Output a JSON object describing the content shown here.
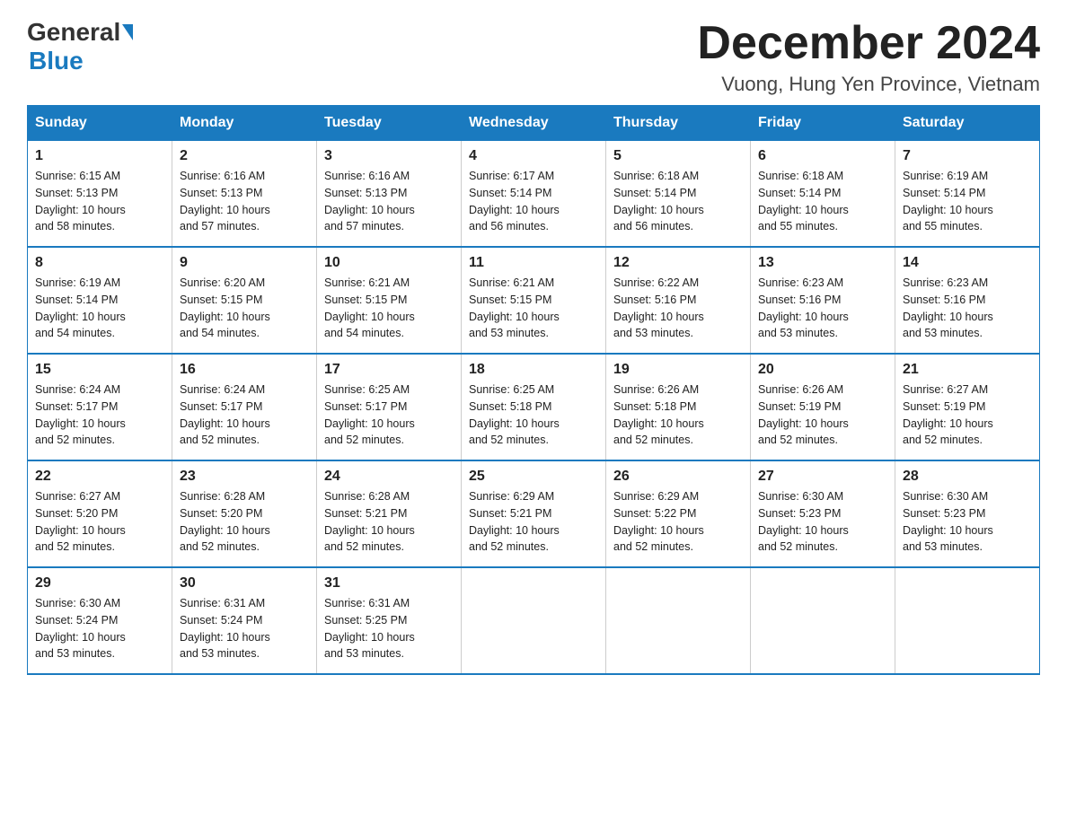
{
  "logo": {
    "general": "General",
    "blue": "Blue"
  },
  "header": {
    "title": "December 2024",
    "location": "Vuong, Hung Yen Province, Vietnam"
  },
  "days_of_week": [
    "Sunday",
    "Monday",
    "Tuesday",
    "Wednesday",
    "Thursday",
    "Friday",
    "Saturday"
  ],
  "weeks": [
    [
      {
        "day": "1",
        "sunrise": "6:15 AM",
        "sunset": "5:13 PM",
        "daylight": "10 hours and 58 minutes."
      },
      {
        "day": "2",
        "sunrise": "6:16 AM",
        "sunset": "5:13 PM",
        "daylight": "10 hours and 57 minutes."
      },
      {
        "day": "3",
        "sunrise": "6:16 AM",
        "sunset": "5:13 PM",
        "daylight": "10 hours and 57 minutes."
      },
      {
        "day": "4",
        "sunrise": "6:17 AM",
        "sunset": "5:14 PM",
        "daylight": "10 hours and 56 minutes."
      },
      {
        "day": "5",
        "sunrise": "6:18 AM",
        "sunset": "5:14 PM",
        "daylight": "10 hours and 56 minutes."
      },
      {
        "day": "6",
        "sunrise": "6:18 AM",
        "sunset": "5:14 PM",
        "daylight": "10 hours and 55 minutes."
      },
      {
        "day": "7",
        "sunrise": "6:19 AM",
        "sunset": "5:14 PM",
        "daylight": "10 hours and 55 minutes."
      }
    ],
    [
      {
        "day": "8",
        "sunrise": "6:19 AM",
        "sunset": "5:14 PM",
        "daylight": "10 hours and 54 minutes."
      },
      {
        "day": "9",
        "sunrise": "6:20 AM",
        "sunset": "5:15 PM",
        "daylight": "10 hours and 54 minutes."
      },
      {
        "day": "10",
        "sunrise": "6:21 AM",
        "sunset": "5:15 PM",
        "daylight": "10 hours and 54 minutes."
      },
      {
        "day": "11",
        "sunrise": "6:21 AM",
        "sunset": "5:15 PM",
        "daylight": "10 hours and 53 minutes."
      },
      {
        "day": "12",
        "sunrise": "6:22 AM",
        "sunset": "5:16 PM",
        "daylight": "10 hours and 53 minutes."
      },
      {
        "day": "13",
        "sunrise": "6:23 AM",
        "sunset": "5:16 PM",
        "daylight": "10 hours and 53 minutes."
      },
      {
        "day": "14",
        "sunrise": "6:23 AM",
        "sunset": "5:16 PM",
        "daylight": "10 hours and 53 minutes."
      }
    ],
    [
      {
        "day": "15",
        "sunrise": "6:24 AM",
        "sunset": "5:17 PM",
        "daylight": "10 hours and 52 minutes."
      },
      {
        "day": "16",
        "sunrise": "6:24 AM",
        "sunset": "5:17 PM",
        "daylight": "10 hours and 52 minutes."
      },
      {
        "day": "17",
        "sunrise": "6:25 AM",
        "sunset": "5:17 PM",
        "daylight": "10 hours and 52 minutes."
      },
      {
        "day": "18",
        "sunrise": "6:25 AM",
        "sunset": "5:18 PM",
        "daylight": "10 hours and 52 minutes."
      },
      {
        "day": "19",
        "sunrise": "6:26 AM",
        "sunset": "5:18 PM",
        "daylight": "10 hours and 52 minutes."
      },
      {
        "day": "20",
        "sunrise": "6:26 AM",
        "sunset": "5:19 PM",
        "daylight": "10 hours and 52 minutes."
      },
      {
        "day": "21",
        "sunrise": "6:27 AM",
        "sunset": "5:19 PM",
        "daylight": "10 hours and 52 minutes."
      }
    ],
    [
      {
        "day": "22",
        "sunrise": "6:27 AM",
        "sunset": "5:20 PM",
        "daylight": "10 hours and 52 minutes."
      },
      {
        "day": "23",
        "sunrise": "6:28 AM",
        "sunset": "5:20 PM",
        "daylight": "10 hours and 52 minutes."
      },
      {
        "day": "24",
        "sunrise": "6:28 AM",
        "sunset": "5:21 PM",
        "daylight": "10 hours and 52 minutes."
      },
      {
        "day": "25",
        "sunrise": "6:29 AM",
        "sunset": "5:21 PM",
        "daylight": "10 hours and 52 minutes."
      },
      {
        "day": "26",
        "sunrise": "6:29 AM",
        "sunset": "5:22 PM",
        "daylight": "10 hours and 52 minutes."
      },
      {
        "day": "27",
        "sunrise": "6:30 AM",
        "sunset": "5:23 PM",
        "daylight": "10 hours and 52 minutes."
      },
      {
        "day": "28",
        "sunrise": "6:30 AM",
        "sunset": "5:23 PM",
        "daylight": "10 hours and 53 minutes."
      }
    ],
    [
      {
        "day": "29",
        "sunrise": "6:30 AM",
        "sunset": "5:24 PM",
        "daylight": "10 hours and 53 minutes."
      },
      {
        "day": "30",
        "sunrise": "6:31 AM",
        "sunset": "5:24 PM",
        "daylight": "10 hours and 53 minutes."
      },
      {
        "day": "31",
        "sunrise": "6:31 AM",
        "sunset": "5:25 PM",
        "daylight": "10 hours and 53 minutes."
      },
      null,
      null,
      null,
      null
    ]
  ]
}
